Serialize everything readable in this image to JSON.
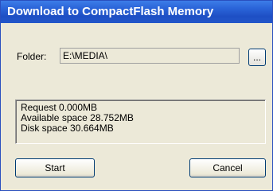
{
  "window": {
    "title": "Download to CompactFlash Memory"
  },
  "folder": {
    "label": "Folder:",
    "value": "E:\\MEDIA\\",
    "browse_label": "..."
  },
  "info": {
    "request": "Request 0.000MB",
    "available": "Available space 28.752MB",
    "disk": "Disk space 30.664MB"
  },
  "buttons": {
    "start": "Start",
    "cancel": "Cancel"
  }
}
